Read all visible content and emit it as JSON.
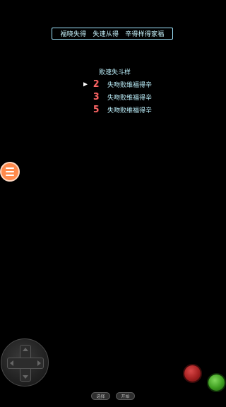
{
  "title_bar": {
    "segments": [
      "福晓失得",
      "失速从得",
      "辛得样得家福"
    ],
    "border_color": "#9fe6ff",
    "text_color": "#bff3ff"
  },
  "menu": {
    "header": "败速失斗样",
    "cursor_glyph": "▶",
    "selected_index": 0,
    "rows": [
      {
        "number": "2",
        "label": "失吻败维福得辛"
      },
      {
        "number": "3",
        "label": "失吻败维福得辛"
      },
      {
        "number": "5",
        "label": "失吻败维福得辛"
      }
    ],
    "number_color": "#ff6b6b"
  },
  "controls": {
    "hamburger_icon": "hamburger-menu-icon",
    "hamburger_color": "#ff8a4c",
    "dpad_icon": "dpad-icon",
    "red_button_color": "#c42a2a",
    "green_button_color": "#4caf2a",
    "select_label": "选择",
    "start_label": "开始"
  }
}
